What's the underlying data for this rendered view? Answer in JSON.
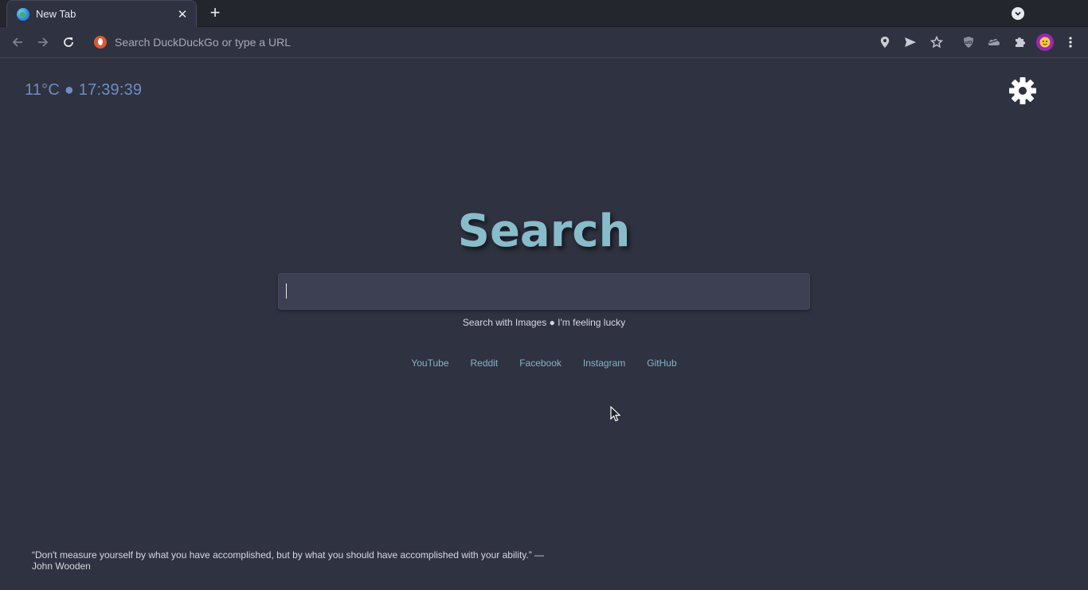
{
  "browser": {
    "tab": {
      "title": "New Tab",
      "close_glyph": "✕",
      "favicon": "globe-icon"
    },
    "new_tab_glyph": "+",
    "omnibox": {
      "placeholder": "Search DuckDuckGo or type a URL",
      "value": "",
      "search_engine_icon": "duckduckgo-icon"
    },
    "toolbar_icons": [
      "back-icon",
      "forward-icon",
      "reload-icon",
      "location-pin-icon",
      "send-icon",
      "star-icon",
      "ublock-shield-icon",
      "cloud-extension-icon",
      "puzzle-extensions-icon",
      "profile-avatar",
      "more-vert-icon"
    ]
  },
  "page": {
    "weather_time": "11°C ● 17:39:39",
    "title": "Search",
    "search": {
      "value": "",
      "images_label": "Search with Images",
      "separator": " ● ",
      "lucky_label": "I'm feeling lucky"
    },
    "links": [
      {
        "label": "YouTube"
      },
      {
        "label": "Reddit"
      },
      {
        "label": "Facebook"
      },
      {
        "label": "Instagram"
      },
      {
        "label": "GitHub"
      }
    ],
    "quote": "“Don't measure yourself by what you have accomplished, but by what you should have accomplished with your ability.” — John Wooden"
  },
  "colors": {
    "page_background": "#2f3240",
    "title": "#88bccb",
    "link": "#84b4c9",
    "weather": "#6f8cc4"
  }
}
